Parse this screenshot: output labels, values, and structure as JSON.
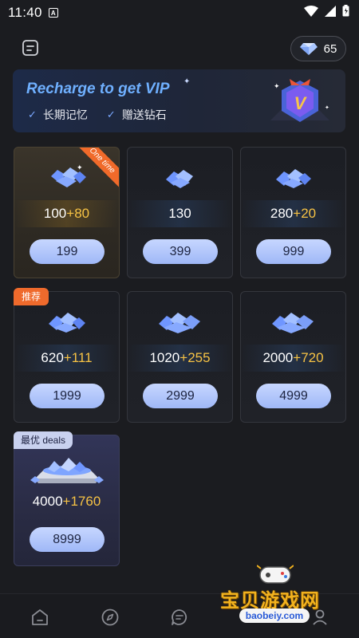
{
  "status_bar": {
    "time": "11:40",
    "notif_letter": "A"
  },
  "balance": {
    "value": "65",
    "icon": "diamond-icon"
  },
  "header": {
    "orders_icon": "document-icon"
  },
  "banner": {
    "title": "Recharge to get VIP",
    "perks": [
      "长期记忆",
      "赠送钻石"
    ],
    "badge_letter": "V"
  },
  "packages": [
    {
      "base": "100",
      "bonus": "+80",
      "price": "199",
      "ribbon": "One time"
    },
    {
      "base": "130",
      "bonus": "",
      "price": "399"
    },
    {
      "base": "280",
      "bonus": "+20",
      "price": "999"
    },
    {
      "base": "620",
      "bonus": "+111",
      "price": "1999",
      "tag": "推荐"
    },
    {
      "base": "1020",
      "bonus": "+255",
      "price": "2999"
    },
    {
      "base": "2000",
      "bonus": "+720",
      "price": "4999"
    },
    {
      "base": "4000",
      "bonus": "+1760",
      "price": "8999",
      "tag": "最优 deals"
    }
  ],
  "nav": [
    "home-icon",
    "compass-icon",
    "chat-icon",
    "profile-icon"
  ],
  "watermark": {
    "title": "宝贝游戏网",
    "url": "baobeiy.com"
  },
  "colors": {
    "accent": "#9fb8f7",
    "bonus": "#f6c244",
    "tag_orange": "#ef6a2c"
  }
}
